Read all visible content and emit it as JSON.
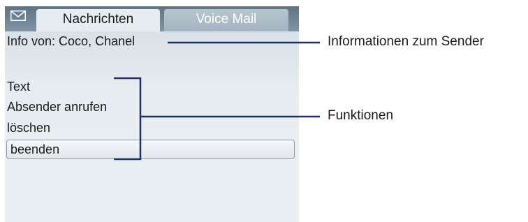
{
  "tabs": [
    {
      "label": "Nachrichten",
      "active": true
    },
    {
      "label": "Voice Mail",
      "active": false
    }
  ],
  "info_line": "Info von: Coco, Chanel",
  "menu": [
    {
      "label": "Text",
      "selected": false
    },
    {
      "label": "Absender anrufen",
      "selected": false
    },
    {
      "label": "löschen",
      "selected": false
    },
    {
      "label": "beenden",
      "selected": true
    }
  ],
  "annotations": {
    "sender_info": "Informationen zum Sender",
    "functions": "Funktionen"
  },
  "colors": {
    "tabbar": "#5d7486",
    "screen_bg": "#e7edf1",
    "leader_line": "#1f2f6b"
  },
  "icons": [
    "envelope-icon"
  ]
}
